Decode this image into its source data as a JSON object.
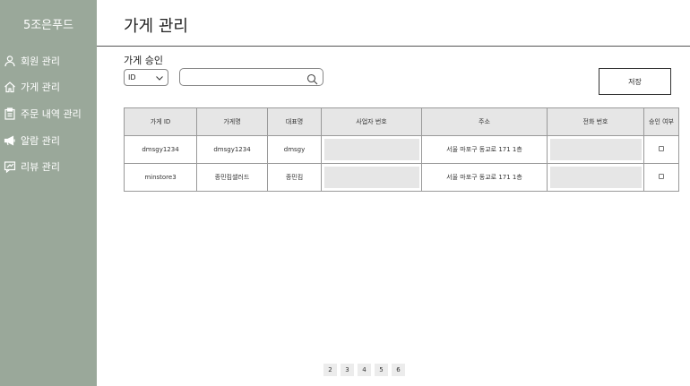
{
  "sidebar": {
    "brand": "5조은푸드",
    "items": [
      {
        "label": "회원 관리",
        "icon": "user-icon"
      },
      {
        "label": "가게 관리",
        "icon": "home-icon"
      },
      {
        "label": "주문 내역 관리",
        "icon": "clipboard-icon"
      },
      {
        "label": "알람 관리",
        "icon": "megaphone-icon"
      },
      {
        "label": "리뷰 관리",
        "icon": "review-icon"
      }
    ]
  },
  "header": {
    "title": "가게 관리"
  },
  "section": {
    "title": "가게 승인"
  },
  "filter": {
    "selected": "ID",
    "search_value": "",
    "search_placeholder": ""
  },
  "toolbar": {
    "save_label": "저장"
  },
  "table": {
    "headers": [
      "가게 ID",
      "가게명",
      "대표명",
      "사업자 번호",
      "주소",
      "전화 번호",
      "승인 여부"
    ],
    "rows": [
      {
        "store_id": "dmsgy1234",
        "store_name": "dmsgy1234",
        "owner": "dmsgy",
        "address": "서울 마포구 동교로 171 1층"
      },
      {
        "store_id": "minstore3",
        "store_name": "종민킴샐러드",
        "owner": "종민킴",
        "address": "서울 마포구 동교로 171 1층"
      }
    ]
  },
  "pagination": {
    "pages": [
      "2",
      "3",
      "4",
      "5",
      "6"
    ]
  },
  "colors": {
    "sidebar_bg": "#9aa89a",
    "header_bg": "#e6e6e6",
    "masked_bg": "#e6e6e6"
  }
}
